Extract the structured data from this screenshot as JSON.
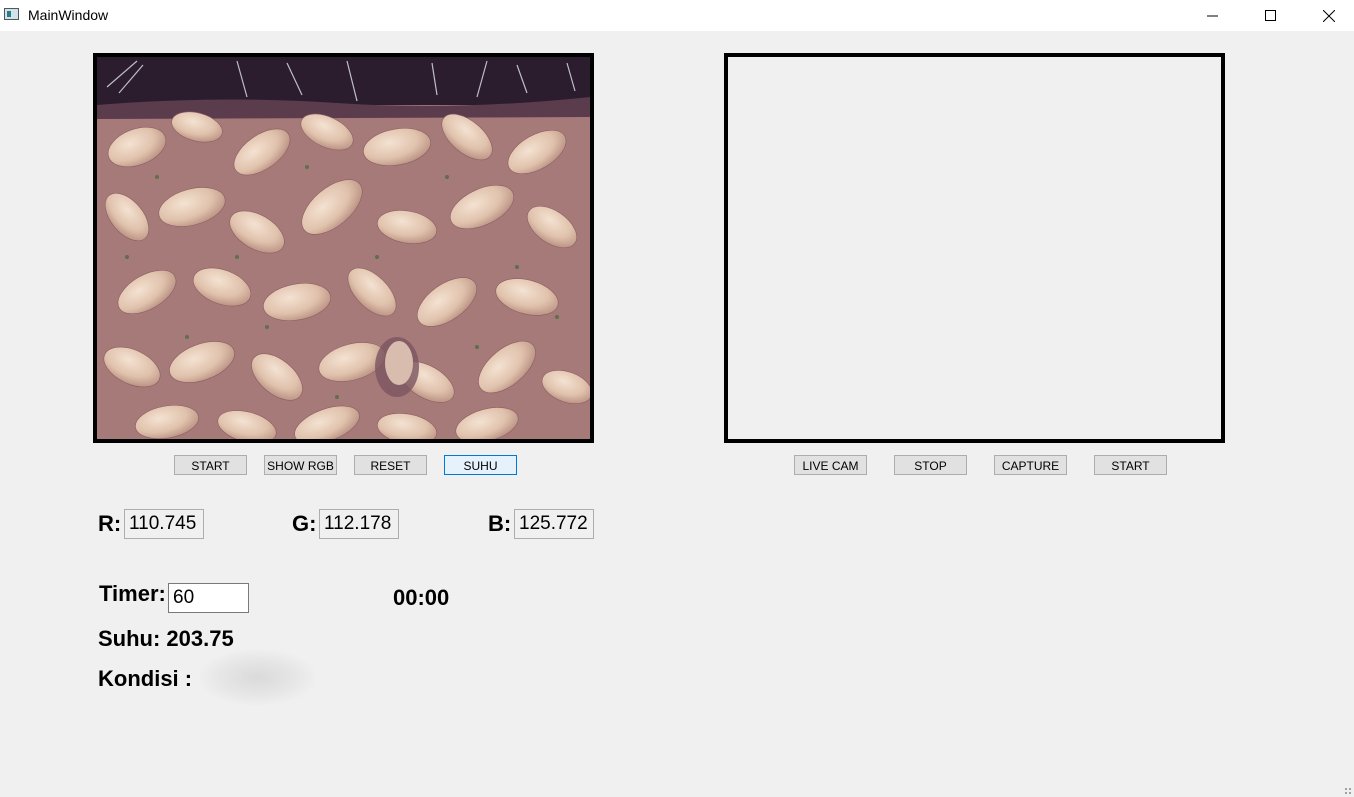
{
  "window": {
    "title": "MainWindow",
    "controls": [
      "minimize-icon",
      "maximize-icon",
      "close-icon"
    ]
  },
  "left_panel": {
    "buttons": {
      "start": "START",
      "show_rgb": "SHOW RGB",
      "reset": "RESET",
      "suhu": "SUHU"
    }
  },
  "right_panel": {
    "buttons": {
      "live_cam": "LIVE CAM",
      "stop": "STOP",
      "capture": "CAPTURE",
      "start": "START"
    }
  },
  "rgb": {
    "r_label": "R:",
    "r_value": "110.745",
    "g_label": "G:",
    "g_value": "112.178",
    "b_label": "B:",
    "b_value": "125.772"
  },
  "timer": {
    "label": "Timer:",
    "value": "60",
    "countdown": "00:00"
  },
  "suhu": {
    "text": "Suhu: 203.75"
  },
  "kondisi": {
    "label": "Kondisi :"
  },
  "colors": {
    "focus_border": "#0078d7",
    "button_bg": "#e1e1e1",
    "window_bg": "#f0f0f0"
  }
}
